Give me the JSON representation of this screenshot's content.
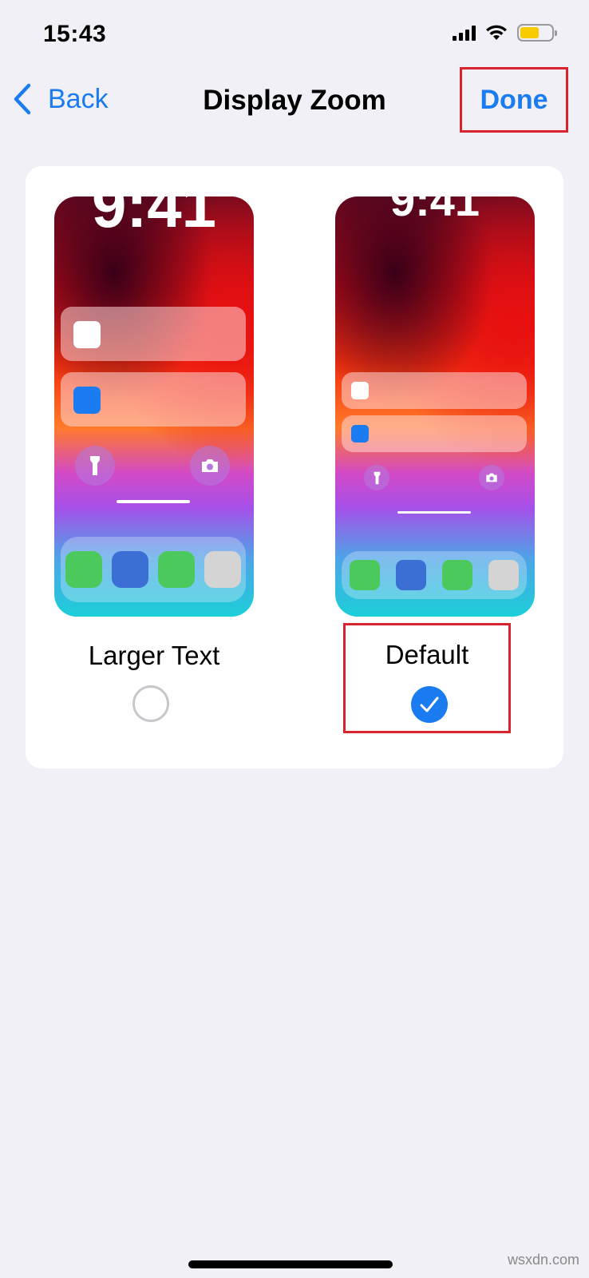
{
  "status_bar": {
    "time": "15:43"
  },
  "nav": {
    "back_label": "Back",
    "title": "Display Zoom",
    "done_label": "Done"
  },
  "previews": {
    "larger_text": {
      "clock": "9:41"
    },
    "default": {
      "clock": "9:41"
    }
  },
  "options": [
    {
      "label": "Larger Text",
      "selected": false
    },
    {
      "label": "Default",
      "selected": true
    }
  ],
  "colors": {
    "accent": "#1a7cf0",
    "highlight": "#d9232e",
    "background": "#f0f0f6"
  },
  "watermark": "wsxdn.com"
}
